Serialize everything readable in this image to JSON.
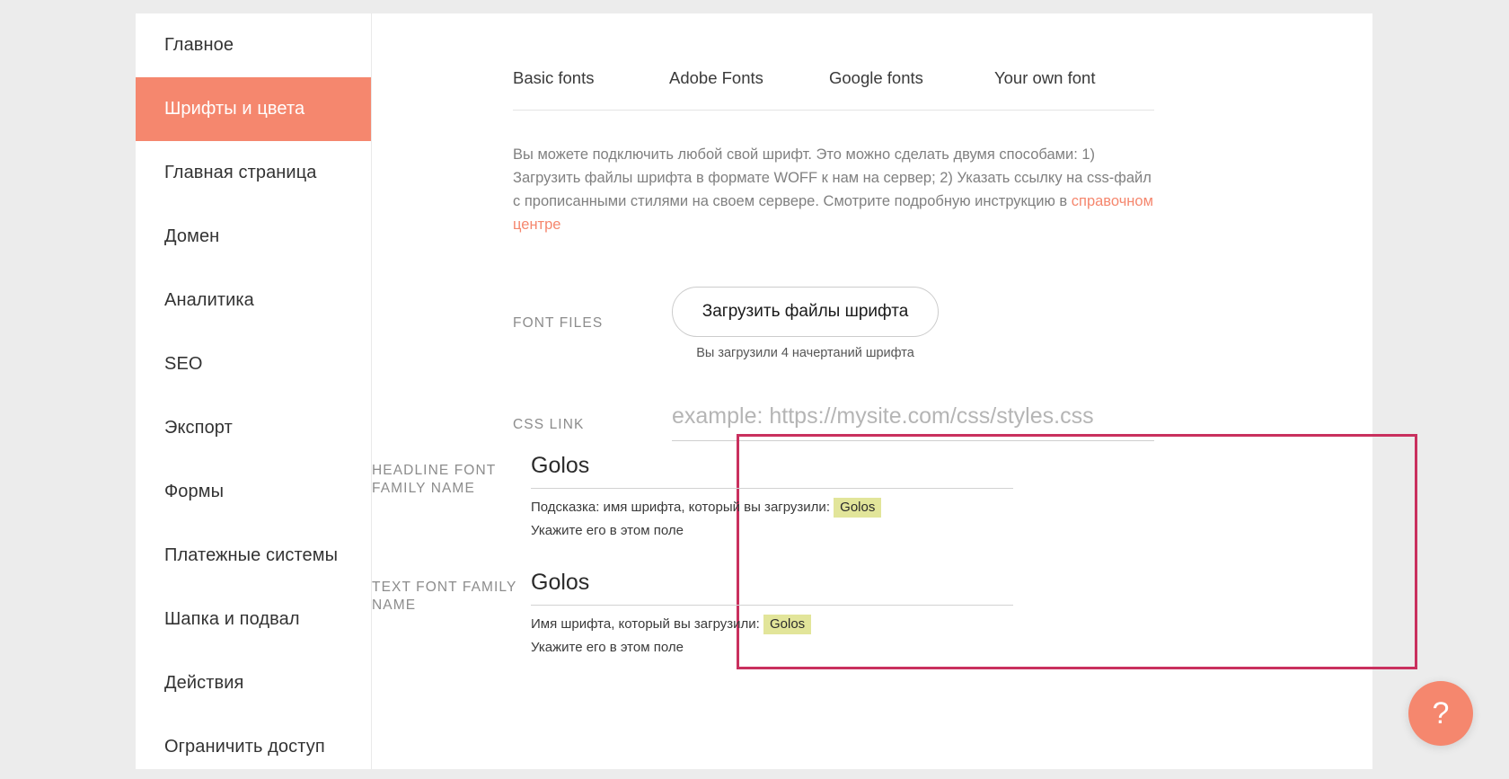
{
  "sidebar": {
    "items": [
      {
        "label": "Главное",
        "active": false
      },
      {
        "label": "Шрифты и цвета",
        "active": true
      },
      {
        "label": "Главная страница",
        "active": false
      },
      {
        "label": "Домен",
        "active": false
      },
      {
        "label": "Аналитика",
        "active": false
      },
      {
        "label": "SEO",
        "active": false
      },
      {
        "label": "Экспорт",
        "active": false
      },
      {
        "label": "Формы",
        "active": false
      },
      {
        "label": "Платежные системы",
        "active": false
      },
      {
        "label": "Шапка и подвал",
        "active": false
      },
      {
        "label": "Действия",
        "active": false
      },
      {
        "label": "Ограничить доступ",
        "active": false
      }
    ]
  },
  "tabs": [
    {
      "label": "Basic fonts",
      "active": false
    },
    {
      "label": "Adobe Fonts",
      "active": false
    },
    {
      "label": "Google fonts",
      "active": false
    },
    {
      "label": "Your own font",
      "active": true
    }
  ],
  "description": {
    "text_before_link": "Вы можете подключить любой свой шрифт. Это можно сделать двумя способами: 1) Загрузить файлы шрифта в формате WOFF к нам на сервер; 2) Указать ссылку на css-файл с прописанными стилями на своем сервере. Смотрите подробную инструкцию в ",
    "link_label": "справочном центре"
  },
  "font_files": {
    "label": "FONT FILES",
    "button_label": "Загрузить файлы шрифта",
    "note": "Вы загрузили 4 начертаний шрифта"
  },
  "css_link": {
    "label": "CSS LINK",
    "value": "",
    "placeholder": "example: https://mysite.com/css/styles.css"
  },
  "headline_font": {
    "label": "HEADLINE FONT FAMILY NAME",
    "value": "Golos",
    "hint_prefix": "Подсказка: имя шрифта, который вы загрузили:",
    "hint_mark": "Golos",
    "hint_second_line": "Укажите его в этом поле"
  },
  "text_font": {
    "label": "TEXT FONT FAMILY NAME",
    "value": "Golos",
    "hint_prefix": "Имя шрифта, который вы загрузили:",
    "hint_mark": "Golos",
    "hint_second_line": "Укажите его в этом поле"
  },
  "help_button": {
    "glyph": "?"
  },
  "colors": {
    "accent": "#f5876e",
    "highlight_border": "#c9305e",
    "mark_background": "#e2e59a",
    "page_background": "#ececec"
  }
}
